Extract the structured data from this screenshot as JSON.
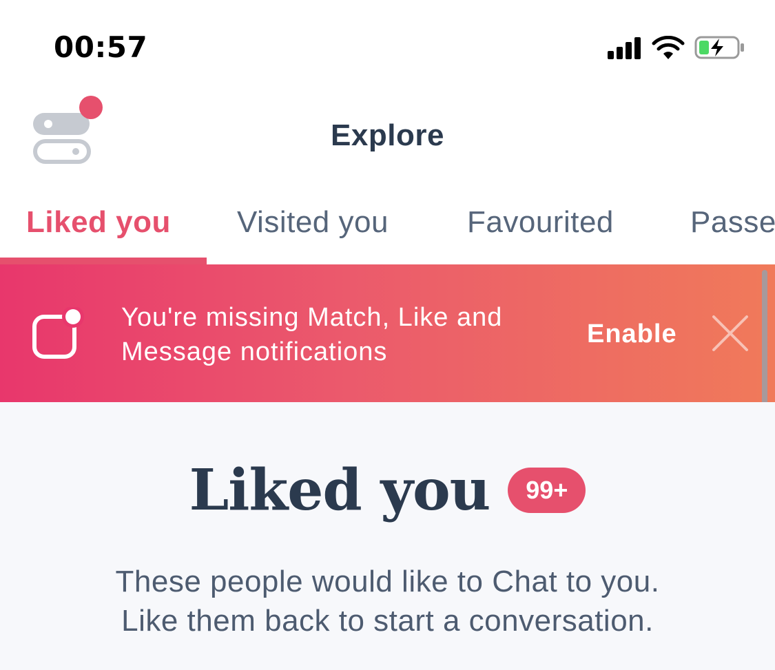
{
  "status_bar": {
    "time": "00:57"
  },
  "header": {
    "title": "Explore",
    "filter_icon": "filter-toggle-icon",
    "notification_dot_color": "#e6506d"
  },
  "tabs": [
    {
      "label": "Liked you",
      "active": true
    },
    {
      "label": "Visited you",
      "active": false
    },
    {
      "label": "Favourited",
      "active": false
    },
    {
      "label": "Passed",
      "active": false
    }
  ],
  "banner": {
    "line1": "You're missing Match, Like and",
    "line2": "Message notifications",
    "enable_label": "Enable",
    "icon": "notification-icon"
  },
  "main": {
    "title": "Liked you",
    "badge": "99+",
    "description_line1": "These people would like to Chat to you.",
    "description_line2": "Like them back to start a conversation."
  },
  "colors": {
    "accent": "#e6506d",
    "text": "#2b3a4e",
    "banner_start": "#e8376c",
    "banner_end": "#f07a5a"
  }
}
